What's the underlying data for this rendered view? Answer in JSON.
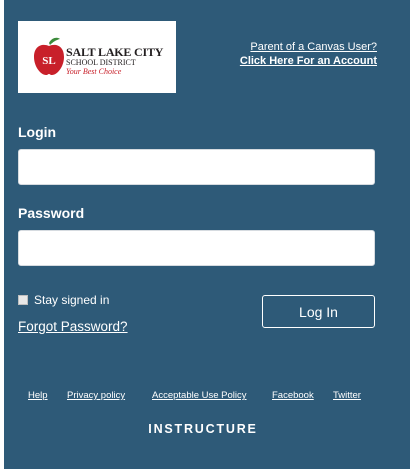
{
  "logo": {
    "line1": "SALT LAKE CITY",
    "line2": "SCHOOL DISTRICT",
    "line3": "Your Best Choice",
    "apple_letters": "SL"
  },
  "parent_link": {
    "line1": "Parent of a Canvas User?",
    "line2": "Click Here For an Account"
  },
  "login_label": "Login",
  "login_value": "",
  "password_label": "Password",
  "password_value": "",
  "stay_signed_in": "Stay signed in",
  "forgot_password": "Forgot Password?",
  "login_button": "Log In",
  "footer": {
    "links": [
      "Help",
      "Privacy policy",
      "Acceptable Use Policy",
      "Facebook",
      "Twitter"
    ],
    "brand": "INSTRUCTURE"
  },
  "colors": {
    "panel": "#2e5a78",
    "logo_red": "#c8202a",
    "white": "#ffffff"
  }
}
